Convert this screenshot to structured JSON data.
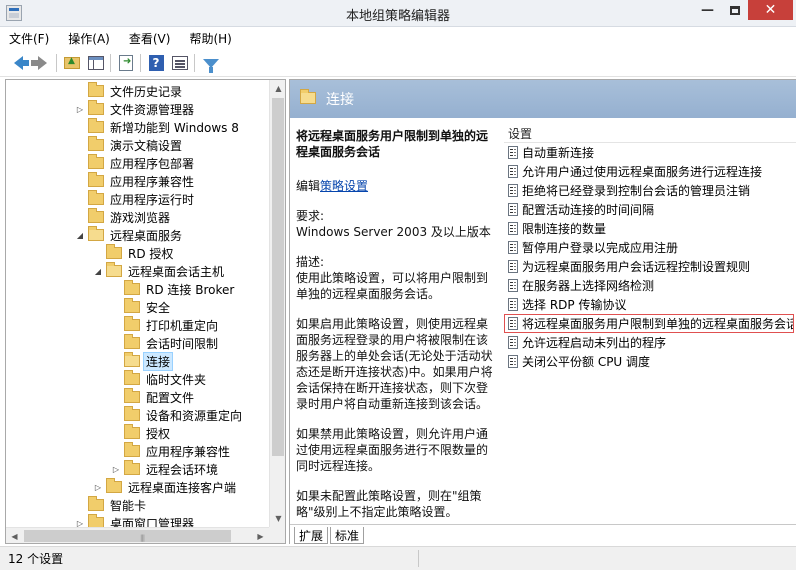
{
  "window": {
    "title": "本地组策略编辑器",
    "minimize": "—",
    "close": "✕"
  },
  "menu": [
    "文件(F)",
    "操作(A)",
    "查看(V)",
    "帮助(H)"
  ],
  "toolbar": {
    "buttons": [
      "back-arrow-icon",
      "forward-arrow-icon",
      "folder-up-icon",
      "show-hide-tree-icon",
      "export-list-icon",
      "help-icon",
      "properties-icon",
      "filter-icon"
    ],
    "help_glyph": "?"
  },
  "tree": [
    {
      "label": "文件历史记录",
      "level": 0,
      "expander": ""
    },
    {
      "label": "文件资源管理器",
      "level": 0,
      "expander": "▷"
    },
    {
      "label": "新增功能到 Windows 8",
      "level": 0,
      "expander": ""
    },
    {
      "label": "演示文稿设置",
      "level": 0,
      "expander": ""
    },
    {
      "label": "应用程序包部署",
      "level": 0,
      "expander": ""
    },
    {
      "label": "应用程序兼容性",
      "level": 0,
      "expander": ""
    },
    {
      "label": "应用程序运行时",
      "level": 0,
      "expander": ""
    },
    {
      "label": "游戏浏览器",
      "level": 0,
      "expander": ""
    },
    {
      "label": "远程桌面服务",
      "level": 0,
      "expander": "◢",
      "open": true
    },
    {
      "label": "RD 授权",
      "level": 1,
      "expander": ""
    },
    {
      "label": "远程桌面会话主机",
      "level": 1,
      "expander": "◢",
      "open": true
    },
    {
      "label": "RD 连接 Broker",
      "level": 2,
      "expander": ""
    },
    {
      "label": "安全",
      "level": 2,
      "expander": ""
    },
    {
      "label": "打印机重定向",
      "level": 2,
      "expander": ""
    },
    {
      "label": "会话时间限制",
      "level": 2,
      "expander": ""
    },
    {
      "label": "连接",
      "level": 2,
      "expander": "",
      "selected": true,
      "open": true
    },
    {
      "label": "临时文件夹",
      "level": 2,
      "expander": ""
    },
    {
      "label": "配置文件",
      "level": 2,
      "expander": ""
    },
    {
      "label": "设备和资源重定向",
      "level": 2,
      "expander": ""
    },
    {
      "label": "授权",
      "level": 2,
      "expander": ""
    },
    {
      "label": "应用程序兼容性",
      "level": 2,
      "expander": ""
    },
    {
      "label": "远程会话环境",
      "level": 2,
      "expander": "▷"
    },
    {
      "label": "远程桌面连接客户端",
      "level": 1,
      "expander": "▷"
    },
    {
      "label": "智能卡",
      "level": 0,
      "expander": ""
    },
    {
      "label": "桌面窗口管理器",
      "level": 0,
      "expander": "▷"
    }
  ],
  "scroll": {
    "up": "▲",
    "down": "▼",
    "left": "◀",
    "right": "▶",
    "grip": "|||"
  },
  "right": {
    "header_title": "连接",
    "desc_title": "将远程桌面服务用户限制到单独的远程桌面服务会话",
    "edit_prefix": "编辑",
    "edit_link": "策略设置",
    "requirements_label": "要求:",
    "requirements": "Windows Server 2003 及以上版本",
    "description_label": "描述:",
    "description": "使用此策略设置，可以将用户限制到单独的远程桌面服务会话。",
    "enabled_text": "如果启用此策略设置，则使用远程桌面服务远程登录的用户将被限制在该服务器上的单处会话(无论处于活动状态还是断开连接状态)中。如果用户将会话保持在断开连接状态，则下次登录时用户将自动重新连接到该会话。",
    "disabled_text": "如果禁用此策略设置，则允许用户通过使用远程桌面服务进行不限数量的同时远程连接。",
    "notconfig_text": "如果未配置此策略设置，则在\"组策略\"级别上不指定此策略设置。",
    "list_header": "设置",
    "settings": [
      "自动重新连接",
      "允许用户通过使用远程桌面服务进行远程连接",
      "拒绝将已经登录到控制台会话的管理员注销",
      "配置活动连接的时间间隔",
      "限制连接的数量",
      "暂停用户登录以完成应用注册",
      "为远程桌面服务用户会话远程控制设置规则",
      "在服务器上选择网络检测",
      "选择 RDP 传输协议",
      "将远程桌面服务用户限制到单独的远程桌面服务会话",
      "允许远程启动未列出的程序",
      "关闭公平份额 CPU 调度"
    ],
    "selected_index": 9,
    "tabs": [
      "扩展",
      "标准"
    ]
  },
  "status": {
    "text": "12 个设置"
  }
}
